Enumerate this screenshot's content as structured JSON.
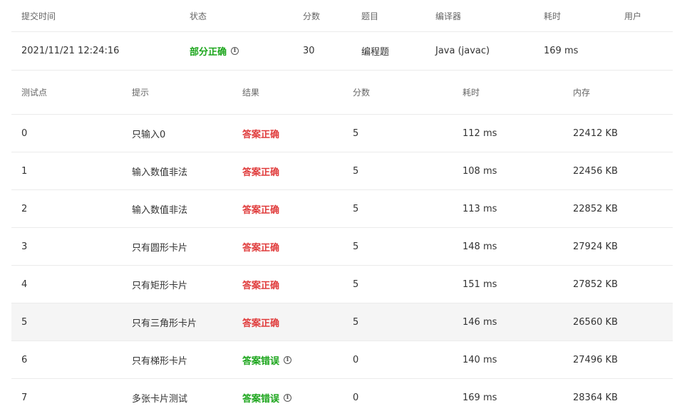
{
  "submission": {
    "headers": [
      "提交时间",
      "状态",
      "分数",
      "题目",
      "编译器",
      "耗时",
      "用户"
    ],
    "row": {
      "time": "2021/11/21 12:24:16",
      "status": "部分正确",
      "status_color": "#1ba51b",
      "score": "30",
      "problem": "编程题",
      "compiler": "Java (javac)",
      "duration": "169 ms",
      "user": ""
    }
  },
  "testcases": {
    "headers": [
      "测试点",
      "提示",
      "结果",
      "分数",
      "耗时",
      "内存"
    ],
    "colors": {
      "correct": "#e03c3c",
      "wrong": "#1ba51b"
    },
    "rows": [
      {
        "id": "0",
        "hint": "只输入0",
        "result": "答案正确",
        "kind": "correct",
        "score": "5",
        "time": "112 ms",
        "memory": "22412 KB"
      },
      {
        "id": "1",
        "hint": "输入数值非法",
        "result": "答案正确",
        "kind": "correct",
        "score": "5",
        "time": "108 ms",
        "memory": "22456 KB"
      },
      {
        "id": "2",
        "hint": "输入数值非法",
        "result": "答案正确",
        "kind": "correct",
        "score": "5",
        "time": "113 ms",
        "memory": "22852 KB"
      },
      {
        "id": "3",
        "hint": "只有圆形卡片",
        "result": "答案正确",
        "kind": "correct",
        "score": "5",
        "time": "148 ms",
        "memory": "27924 KB"
      },
      {
        "id": "4",
        "hint": "只有矩形卡片",
        "result": "答案正确",
        "kind": "correct",
        "score": "5",
        "time": "151 ms",
        "memory": "27852 KB"
      },
      {
        "id": "5",
        "hint": "只有三角形卡片",
        "result": "答案正确",
        "kind": "correct",
        "score": "5",
        "time": "146 ms",
        "memory": "26560 KB"
      },
      {
        "id": "6",
        "hint": "只有梯形卡片",
        "result": "答案错误",
        "kind": "wrong",
        "score": "0",
        "time": "140 ms",
        "memory": "27496 KB"
      },
      {
        "id": "7",
        "hint": "多张卡片测试",
        "result": "答案错误",
        "kind": "wrong",
        "score": "0",
        "time": "169 ms",
        "memory": "28364 KB"
      }
    ]
  }
}
